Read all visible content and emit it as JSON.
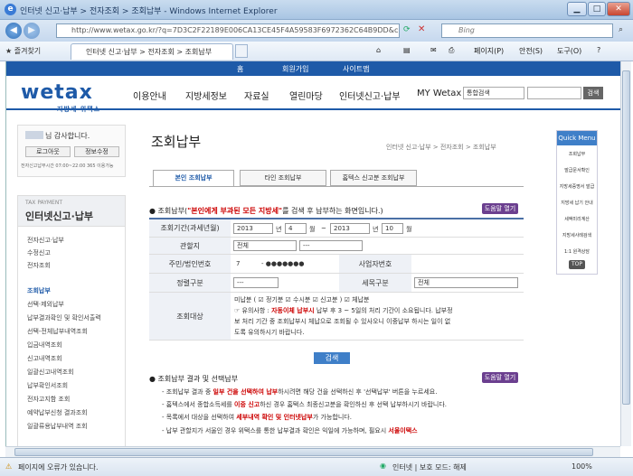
{
  "window": {
    "title": "인터넷 신고·납부 > 전자조회 > 조회납부 - Windows Internet Explorer",
    "url": "http://www.wetax.go.kr/?q=7D3C2F22189E006CA13CE45F4A59583F6972362C64B9DD&charset=eu",
    "search_placeholder": "Bing",
    "favorites_label": "즐겨찾기",
    "tab_label": "인터넷 신고·납부 > 전자조회 > 조회납부",
    "tools": {
      "page": "페이지(P)",
      "safety": "안전(S)",
      "tools": "도구(O)"
    },
    "status_left": "페이지에 오류가 있습니다.",
    "status_zone": "인터넷 | 보호 모드: 해제",
    "zoom": "100%"
  },
  "site": {
    "topnav": [
      "홈",
      "회원가입",
      "사이트맵"
    ],
    "logo": "wetax",
    "logo_sub": "지방세 위택스",
    "gnb": [
      "이용안내",
      "지방세정보",
      "자료실",
      "열린마당",
      "인터넷신고·납부",
      "MY Wetax"
    ],
    "search_select": "통합검색",
    "search_btn": "검색"
  },
  "left": {
    "welcome": "님 감사합니다.",
    "logout": "로그아웃",
    "myinfo": "정보수정",
    "session": "전자신고납부시간 07:00~22:00 365 이용가능",
    "menu_en": "TAX PAYMENT",
    "menu_title": "인터넷신고·납부",
    "items": [
      "전자신고·납부",
      "수정신고",
      "전자조회",
      "조회납부",
      "선택·제외납부",
      "납부결과확인 및 확인서출력",
      "선택-전체납부내역조회",
      "입금내역조회",
      "신고내역조회",
      "일괄신고내역조회",
      "납부확인서조회",
      "전자고지함 조회",
      "예약납부신청 결과조회",
      "일괄류용납부내역 조회"
    ]
  },
  "main": {
    "title": "조회납부",
    "breadcrumb": "인터넷 신고·납부 > 전자조회 > 조회납부",
    "tabs": [
      "본인 조회납부",
      "타인 조회납부",
      "홈텍스 신고분 조회납부"
    ],
    "section1_pre": "조회납부(",
    "section1_em": "\"본인에게 부과된 모든 지방세\"",
    "section1_post": "를 검색 후 납부하는 화면입니다.)",
    "help": "도움말 열기",
    "form": {
      "period_label": "조회기간(과세년월)",
      "y1": "2013",
      "m1": "4",
      "y2": "2013",
      "m2": "10",
      "u_year": "년",
      "u_month": "월",
      "tilde": "~",
      "region_label": "관할지",
      "region_val": "전체",
      "region_val2": "---",
      "id_label": "주민/법인번호",
      "id_val": "7",
      "id_mask": "- ●●●●●●●",
      "biz_label": "사업자번호",
      "regular_label": "정렬구분",
      "regular_val": "---",
      "taxtype_label": "세목구분",
      "taxtype_val": "전체",
      "target_label": "조회대상",
      "targets": "미납분 ( ☑ 정기분  ☑ 수시분  ☑ 신고분 )  ☑ 체납분",
      "caution1_pre": "☞ 유의사항 : ",
      "caution1_red": "자동이체 납부시",
      "caution1_post": " 납부 후 3 ~ 5일의 처리 기간이 소요됩니다. 납부정",
      "caution2": "보 처리 기간 중 조회납부시 체납으로 조회될 수 있사오니 이중납부 하시는 일이 없",
      "caution3": "도록 유의하시기 바랍니다."
    },
    "search_btn": "검색",
    "section2": "조회납부 결과 및 선택납부",
    "notes": [
      {
        "a": "- 조회납부 결과 중 ",
        "r": "일부 건을 선택하여 납부",
        "b": "하시려면 해당 건을 선택하신 후 '선택납부' 버튼을 누르세요."
      },
      {
        "a": "- 홈텍스에서 종합소득세를 ",
        "r": "이중 신고",
        "b": "하신 경우 홈택스 최종신고분을 확인하신 후 선택 납부하시기 바랍니다."
      },
      {
        "a": "- 목록에서 대상을 선택하여 ",
        "r": "세부내역 확인 및 인터넷납부",
        "b": "가 가능합니다."
      },
      {
        "a": "- 납부 관할지가 서울인 경우 위택스를 통한 납부결과 확인은 익일에 가능하며, 필요시 ",
        "r": "서울이택스",
        "b": ""
      }
    ]
  },
  "quick": {
    "title": "Quick Menu",
    "items": [
      "조회납부",
      "발급문서확인",
      "지방세증명서 발급",
      "지방세 납기 안내",
      "세액미리계산",
      "지방세사례검색",
      "1:1 원격상담"
    ],
    "top": "TOP"
  }
}
